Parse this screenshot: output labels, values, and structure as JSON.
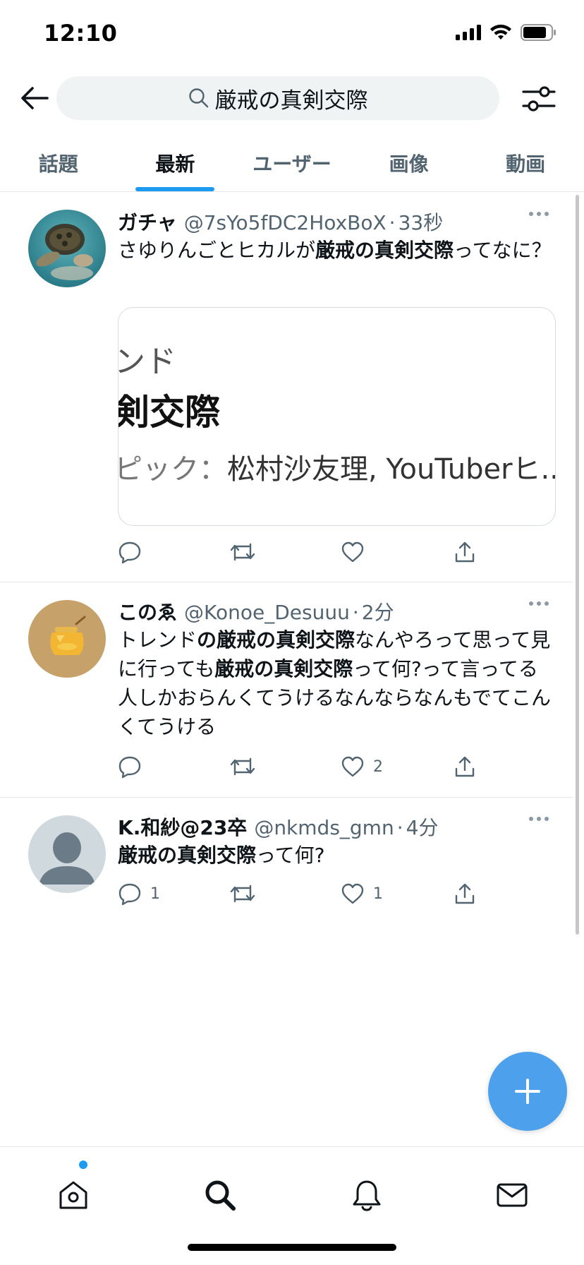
{
  "status_bar": {
    "time": "12:10"
  },
  "search": {
    "query": "厳戒の真剣交際"
  },
  "tabs": [
    {
      "label": "話題",
      "active": false
    },
    {
      "label": "最新",
      "active": true
    },
    {
      "label": "ユーザー",
      "active": false
    },
    {
      "label": "画像",
      "active": false
    },
    {
      "label": "動画",
      "active": false
    }
  ],
  "tweets": [
    {
      "name": "ガチャ",
      "handle": "@7sYo5fDC2HoxBoX",
      "time": "33秒",
      "text_parts": [
        {
          "text": "さゆりんごとヒカルが",
          "bold": false
        },
        {
          "text": "厳戒の真剣交際",
          "bold": true
        },
        {
          "text": "ってなに？",
          "bold": false
        }
      ],
      "media": {
        "line1": "ンド",
        "line2": "剣交際",
        "line3_prefix": "ピック：",
        "line3_rest": "松村沙友理, YouTuberヒ..."
      },
      "reply_count": "",
      "retweet_count": "",
      "like_count": ""
    },
    {
      "name": "このゑ",
      "handle": "@Konoe_Desuuu",
      "time": "2分",
      "text_parts": [
        {
          "text": "トレンド",
          "bold": false
        },
        {
          "text": "の厳戒の真剣交際",
          "bold": true
        },
        {
          "text": "なんやろって思って見に行っても",
          "bold": false
        },
        {
          "text": "厳戒の真剣交際",
          "bold": true
        },
        {
          "text": "って何?って言ってる人しかおらんくてうけるなんならなんもでてこんくてうける",
          "bold": false
        }
      ],
      "reply_count": "",
      "retweet_count": "",
      "like_count": "2"
    },
    {
      "name": "K.和紗@23卒",
      "handle": "@nkmds_gmn",
      "time": "4分",
      "text_parts": [
        {
          "text": "厳戒の真剣交際",
          "bold": true
        },
        {
          "text": "って何?",
          "bold": false
        }
      ],
      "reply_count": "1",
      "retweet_count": "",
      "like_count": "1"
    }
  ],
  "colors": {
    "accent": "#1d9bf0",
    "fab": "#4ca0ec",
    "secondary_text": "#536471"
  },
  "icons": [
    "back-arrow-icon",
    "search-icon",
    "filter-icon",
    "reply-icon",
    "retweet-icon",
    "like-icon",
    "share-icon",
    "compose-icon",
    "home-icon",
    "explore-icon",
    "notifications-icon",
    "messages-icon"
  ]
}
